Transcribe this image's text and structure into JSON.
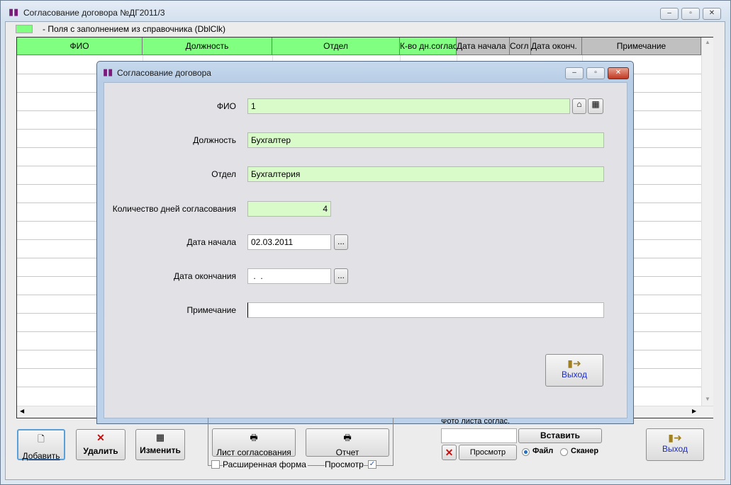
{
  "main_window": {
    "title": "Согласование договора №ДГ2011/3",
    "legend_text": "-  Поля с заполнением из справочника (DblClk)",
    "legend_color": "#80ff80"
  },
  "grid": {
    "columns": [
      "ФИО",
      "Должность",
      "Отдел",
      "К-во дн.согласования",
      "Дата начала",
      "Согл",
      "Дата оконч.",
      "Примечание"
    ]
  },
  "dialog": {
    "title": "Согласование договора",
    "fields": {
      "fio": {
        "label": "ФИО",
        "value": "1"
      },
      "position": {
        "label": "Должность",
        "value": "Бухгалтер"
      },
      "department": {
        "label": "Отдел",
        "value": "Бухгалтерия"
      },
      "days": {
        "label": "Количество дней согласования",
        "value": "4"
      },
      "start": {
        "label": "Дата начала",
        "value": "02.03.2011"
      },
      "end": {
        "label": "Дата окончания",
        "value": " .  ."
      },
      "note": {
        "label": "Примечание",
        "value": ""
      }
    },
    "browse": "...",
    "exit": "Выход"
  },
  "toolbar": {
    "add": "Добавить",
    "delete": "Удалить",
    "edit": "Изменить",
    "sheet": "Лист согласования",
    "report": "Отчет",
    "extended_form": "Расширенная форма",
    "preview_label": "Просмотр",
    "photo_label": "Фото листа соглас.",
    "insert": "Вставить",
    "view": "Просмотр",
    "file": "Файл",
    "scanner": "Сканер",
    "exit": "Выход"
  }
}
